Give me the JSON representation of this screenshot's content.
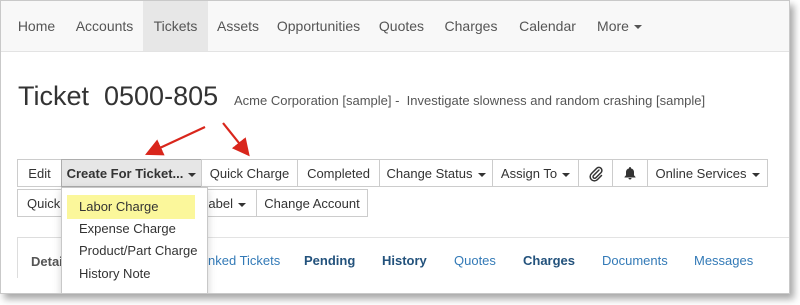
{
  "nav": {
    "items": [
      "Home",
      "Accounts",
      "Tickets",
      "Assets",
      "Opportunities",
      "Quotes",
      "Charges",
      "Calendar",
      "More"
    ],
    "active": "Tickets"
  },
  "ticket": {
    "title": "Ticket  0500-805",
    "subtitle": "Acme Corporation [sample] -  Investigate slowness and random crashing [sample]"
  },
  "toolbar": {
    "edit": "Edit",
    "create_for_ticket": "Create For Ticket...",
    "quick_charge": "Quick Charge",
    "completed": "Completed",
    "change_status": "Change Status",
    "assign_to": "Assign To",
    "paperclip_icon": "paperclip-icon",
    "bell_icon": "bell-icon",
    "online_services": "Online Services",
    "quick_partial": "Quick",
    "label": "Label",
    "change_account": "Change Account"
  },
  "dropdown": {
    "items": [
      "Labor Charge",
      "Expense Charge",
      "Product/Part Charge",
      "History Note"
    ],
    "highlighted": "Labor Charge",
    "highlight_color": "#fbf79b"
  },
  "tabs": {
    "items": [
      "Detai",
      "nked Tickets",
      "Pending",
      "History",
      "Quotes",
      "Charges",
      "Documents",
      "Messages"
    ],
    "active": "Detai"
  },
  "colors": {
    "annotation_arrow": "#d9261c",
    "link": "#337ab7",
    "nav_bg": "#f8f8f8"
  }
}
